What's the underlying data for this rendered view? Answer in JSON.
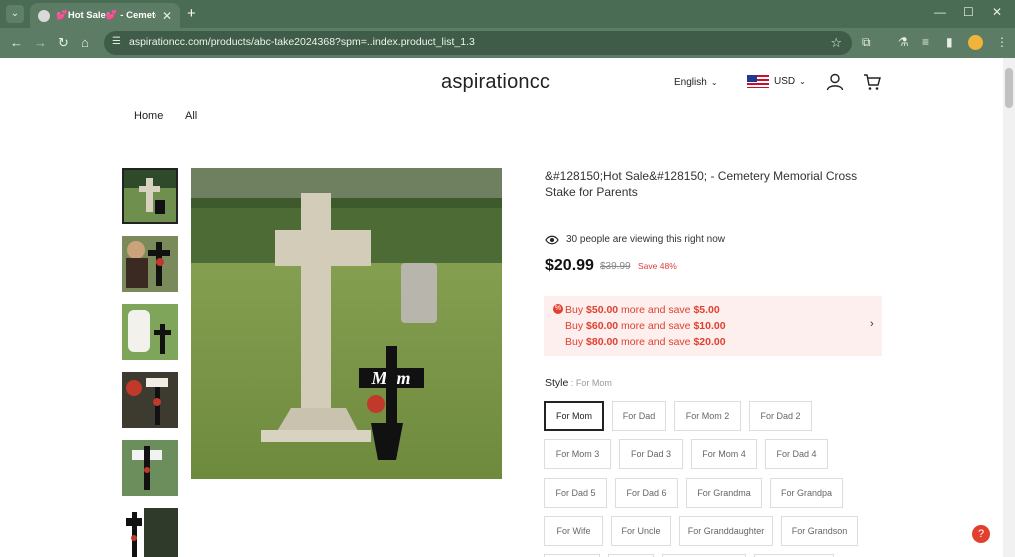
{
  "browser": {
    "tab_title": "💕Hot Sale💕 - Cemetery Memorial Cross Stake for Parents",
    "url": "aspirationcc.com/products/abc-take2024368?spm=..index.product_list_1.3",
    "new_tab_label": "+"
  },
  "header": {
    "logo": "aspirationcc",
    "language": "English",
    "currency": "USD"
  },
  "menu": [
    "Home",
    "All"
  ],
  "product": {
    "title": "&#128150;Hot Sale&#128150; - Cemetery Memorial Cross Stake for Parents",
    "viewers": "30 people are viewing this right now",
    "price": "$20.99",
    "old_price": "$39.99",
    "save": "Save 48%",
    "promotions": [
      {
        "pre": "Buy ",
        "amount": "$50.00",
        "mid": " more and save ",
        "save": "$5.00"
      },
      {
        "pre": "Buy ",
        "amount": "$60.00",
        "mid": " more and save ",
        "save": "$10.00"
      },
      {
        "pre": "Buy ",
        "amount": "$80.00",
        "mid": " more and save ",
        "save": "$20.00"
      }
    ],
    "style_label": "Style",
    "style_selected": " : For Mom",
    "style_options": [
      "For Mom",
      "For Dad",
      "For Mom 2",
      "For Dad 2",
      "For Mom 3",
      "For Dad 3",
      "For Mom 4",
      "For Dad 4",
      "For Dad 5",
      "For Dad 6",
      "For Grandma",
      "For Grandpa",
      "For Wife",
      "For Uncle",
      "For Granddaughter",
      "For Grandson"
    ],
    "main_image_text": "Mom"
  },
  "colors": {
    "accent": "#e2402f",
    "chrome": "#4a6b54"
  }
}
